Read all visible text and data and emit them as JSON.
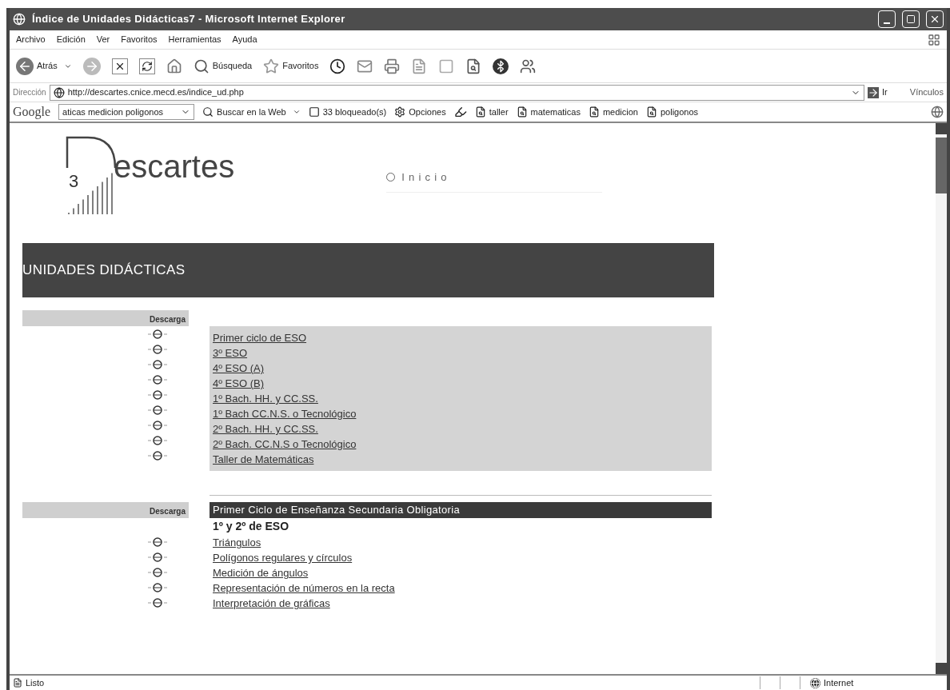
{
  "window": {
    "title": "Índice de Unidades Didácticas7 - Microsoft Internet Explorer"
  },
  "menu": [
    "Archivo",
    "Edición",
    "Ver",
    "Favoritos",
    "Herramientas",
    "Ayuda"
  ],
  "toolbar": {
    "back": "Atrás",
    "search": "Búsqueda",
    "favorites": "Favoritos"
  },
  "address": {
    "label": "Dirección",
    "value": "http://descartes.cnice.mecd.es/indice_ud.php",
    "go": "Ir",
    "links": "Vínculos"
  },
  "google_bar": {
    "logo": "Google",
    "query": "aticas medicion poligonos",
    "search_web": "Buscar en la Web",
    "blocked": "33 bloqueado(s)",
    "options": "Opciones",
    "highlights": [
      "taller",
      "matematicas",
      "medicion",
      "poligonos"
    ]
  },
  "page": {
    "logo_digit": "3",
    "logo_text": "escartes",
    "home_link": "Inicio",
    "banner": "UNIDADES DIDÁCTICAS",
    "sections": [
      {
        "download_header": "Descarga",
        "links": [
          "Primer ciclo de ESO",
          "3º ESO",
          "4º ESO (A)",
          "4º ESO (B)",
          "1º Bach. HH. y CC.SS.",
          "1º Bach CC.N.S. o Tecnológico",
          "2º Bach. HH. y CC.SS.",
          "2º Bach. CC.N.S o Tecnológico",
          "Taller de Matemáticas"
        ]
      },
      {
        "download_header": "Descarga",
        "title": "Primer Ciclo de Enseñanza Secundaria Obligatoria",
        "subtitle": "1º y 2º de ESO",
        "links": [
          "Triángulos",
          "Polígonos regulares y círculos",
          "Medición de ángulos",
          "Representación de números en la recta",
          "Interpretación de gráficas"
        ]
      }
    ]
  },
  "status_bar": {
    "text": "Listo",
    "zone": "Internet"
  }
}
